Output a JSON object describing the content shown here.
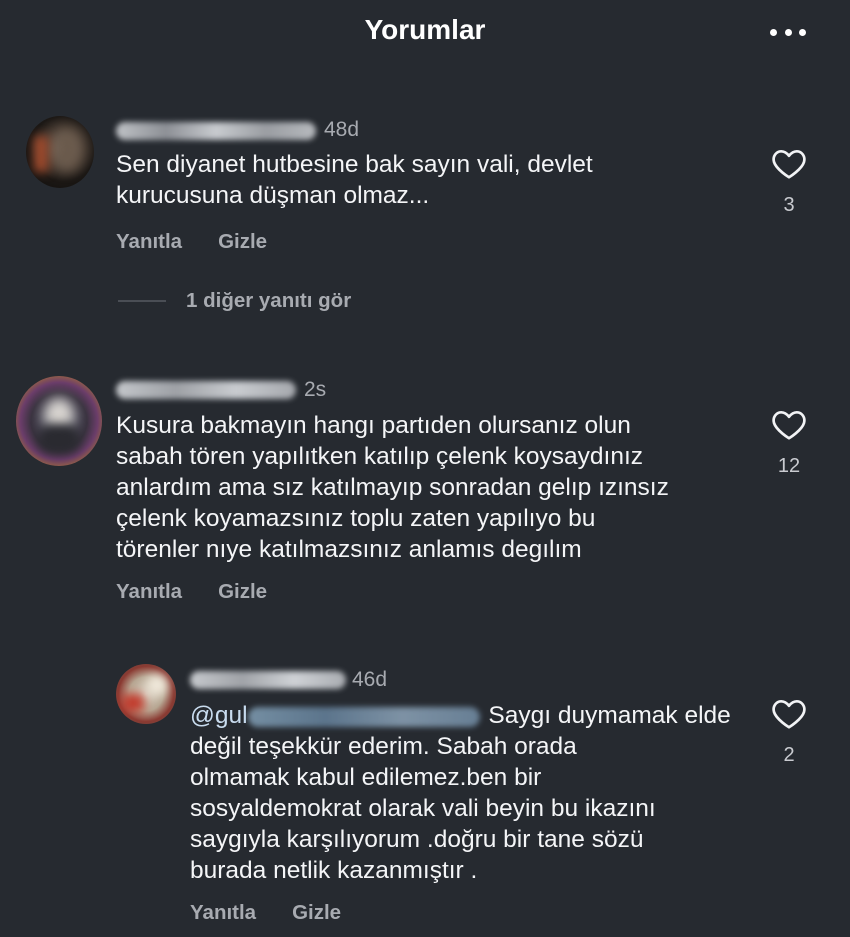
{
  "header": {
    "title": "Yorumlar"
  },
  "comments": [
    {
      "time": "48d",
      "lines": [
        "Sen diyanet hutbesine bak sayın vali, devlet",
        "kurucusuna düşman olmaz..."
      ],
      "reply_label": "Yanıtla",
      "hide_label": "Gizle",
      "like_count": "3",
      "view_replies": "1 diğer yanıtı gör"
    },
    {
      "time": "2s",
      "lines": [
        "Kusura bakmayın hangı partıden olursanız olun",
        "sabah tören yapılıtken katılıp çelenk koysaydınız",
        "anlardım ama sız katılmayıp sonradan gelıp ızınsız",
        "çelenk koyamazsınız toplu zaten yapılıyo bu",
        "törenler nıye katılmazsınız anlamıs degılım"
      ],
      "reply_label": "Yanıtla",
      "hide_label": "Gizle",
      "like_count": "12"
    },
    {
      "time": "46d",
      "mention": "@gul",
      "first_line_rest": "Saygı duymamak elde",
      "lines": [
        "değil teşekkür ederim. Sabah orada",
        "olmamak kabul edilemez.ben bir",
        "sosyaldemokrat olarak vali beyin bu ikazını",
        "saygıyla karşılıyorum .doğru bir tane sözü",
        "burada netlik kazanmıştır ."
      ],
      "reply_label": "Yanıtla",
      "hide_label": "Gizle",
      "like_count": "2"
    }
  ],
  "icons": {
    "more": "more-horizontal-icon",
    "like": "heart-outline-icon"
  },
  "colors": {
    "background": "#262a30",
    "text": "#f4f5f7",
    "muted": "#a8abb1"
  }
}
